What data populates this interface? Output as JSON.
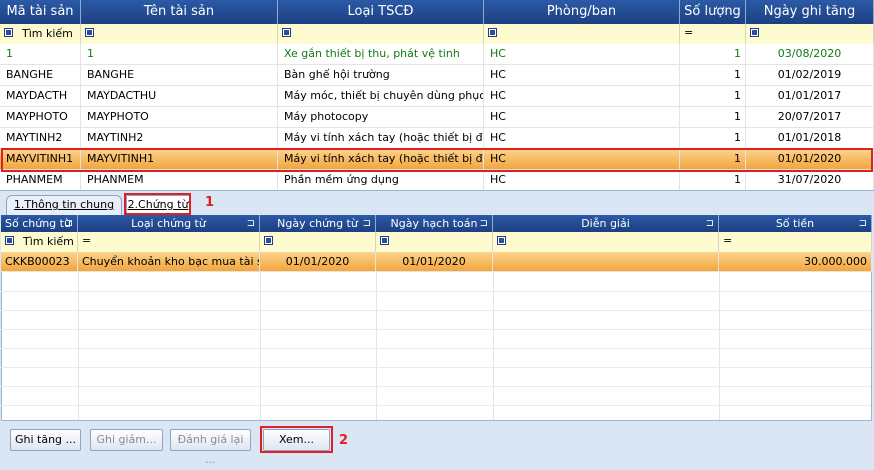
{
  "asset_grid": {
    "columns": [
      "Mã tài sản",
      "Tên tài sản",
      "Loại TSCĐ",
      "Phòng/ban",
      "Số lượng",
      "Ngày ghi tăng"
    ],
    "filter": {
      "search_label": "Tìm kiếm",
      "qty_op": "="
    },
    "rows": [
      [
        "1",
        "1",
        "Xe gắn thiết bị thu, phát vệ tinh",
        "HC",
        "1",
        "03/08/2020"
      ],
      [
        "BANGHE",
        "BANGHE",
        "Bàn ghế hội trường",
        "HC",
        "1",
        "01/02/2019"
      ],
      [
        "MAYDACTH",
        "MAYDACTHU",
        "Máy móc, thiết bị chuyên dùng phục vụ",
        "HC",
        "1",
        "01/01/2017"
      ],
      [
        "MAYPHOTO",
        "MAYPHOTO",
        "Máy photocopy",
        "HC",
        "1",
        "20/07/2017"
      ],
      [
        "MAYTINH2",
        "MAYTINH2",
        "Máy vi tính xách tay (hoặc thiết bị điện",
        "HC",
        "1",
        "01/01/2018"
      ],
      [
        "MAYVITINH1",
        "MAYVITINH1",
        "Máy vi tính xách tay (hoặc thiết bị điện",
        "HC",
        "1",
        "01/01/2020"
      ],
      [
        "PHANMEM",
        "PHANMEM",
        "Phần mềm ứng dụng",
        "HC",
        "1",
        "31/07/2020"
      ]
    ]
  },
  "tabs": {
    "general": "1.Thông tin chung",
    "vouchers": "2.Chứng từ"
  },
  "voucher_grid": {
    "columns": [
      "Số chứng từ",
      "Loại chứng từ",
      "Ngày chứng từ",
      "Ngày hạch toán",
      "Diễn giải",
      "Số tiền"
    ],
    "filter": {
      "search_label": "Tìm kiếm",
      "op_eq": "="
    },
    "rows": [
      [
        "CKKB00023",
        "Chuyển khoản kho bạc mua tài s...",
        "01/01/2020",
        "01/01/2020",
        "",
        "30.000.000"
      ]
    ]
  },
  "buttons": {
    "increase": "Ghi tăng ...",
    "decrease": "Ghi giảm...",
    "revalue": "Đánh giá lại ...",
    "view": "Xem..."
  },
  "annotations": {
    "step1": "1",
    "step2": "2"
  },
  "colors": {
    "header": "#2b5aa6",
    "selected_row": "#f3a338",
    "highlight": "#e02020",
    "green_text": "#127a12"
  }
}
